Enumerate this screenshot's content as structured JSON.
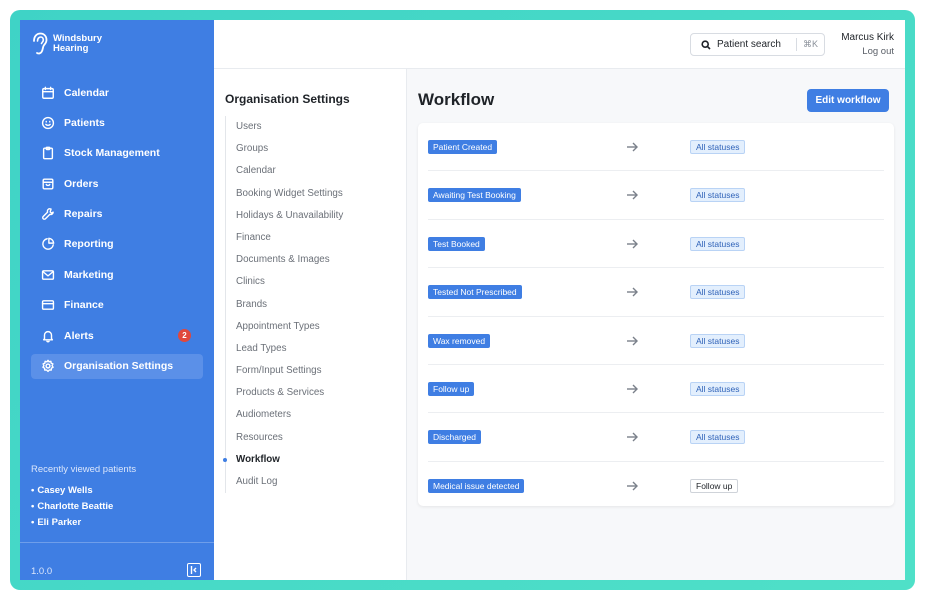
{
  "brand": {
    "line1": "Windsbury",
    "line2": "Hearing"
  },
  "sidebar": {
    "items": [
      {
        "label": "Calendar",
        "icon": "calendar-icon"
      },
      {
        "label": "Patients",
        "icon": "smile-icon"
      },
      {
        "label": "Stock Management",
        "icon": "clipboard-icon"
      },
      {
        "label": "Orders",
        "icon": "box-icon"
      },
      {
        "label": "Repairs",
        "icon": "wrench-icon"
      },
      {
        "label": "Reporting",
        "icon": "pie-chart-icon"
      },
      {
        "label": "Marketing",
        "icon": "mail-icon"
      },
      {
        "label": "Finance",
        "icon": "credit-card-icon"
      },
      {
        "label": "Alerts",
        "icon": "bell-icon",
        "badge": "2"
      },
      {
        "label": "Organisation Settings",
        "icon": "gear-icon",
        "active": true
      }
    ],
    "recent_title": "Recently viewed patients",
    "recent": [
      "Casey Wells",
      "Charlotte Beattie",
      "Eli Parker"
    ],
    "version": "1.0.0"
  },
  "topbar": {
    "search_label": "Patient search",
    "search_shortcut": "⌘K",
    "user_name": "Marcus Kirk",
    "logout": "Log out"
  },
  "settings": {
    "title": "Organisation Settings",
    "items": [
      "Users",
      "Groups",
      "Calendar",
      "Booking Widget Settings",
      "Holidays & Unavailability",
      "Finance",
      "Documents & Images",
      "Clinics",
      "Brands",
      "Appointment Types",
      "Lead Types",
      "Form/Input Settings",
      "Products & Services",
      "Audiometers",
      "Resources",
      "Workflow",
      "Audit Log"
    ],
    "active": "Workflow"
  },
  "main": {
    "title": "Workflow",
    "edit_button": "Edit workflow",
    "rows": [
      {
        "from": "Patient Created",
        "to": "All statuses"
      },
      {
        "from": "Awaiting Test Booking",
        "to": "All statuses"
      },
      {
        "from": "Test Booked",
        "to": "All statuses"
      },
      {
        "from": "Tested Not Prescribed",
        "to": "All statuses"
      },
      {
        "from": "Wax removed",
        "to": "All statuses"
      },
      {
        "from": "Follow up",
        "to": "All statuses"
      },
      {
        "from": "Discharged",
        "to": "All statuses"
      },
      {
        "from": "Medical issue detected",
        "to": "Follow up"
      }
    ]
  },
  "colors": {
    "sidebar_bg": "#3f7ee3",
    "accent": "#3f7ee3",
    "frame": "#3fd3c6",
    "badge": "#e0483c"
  }
}
